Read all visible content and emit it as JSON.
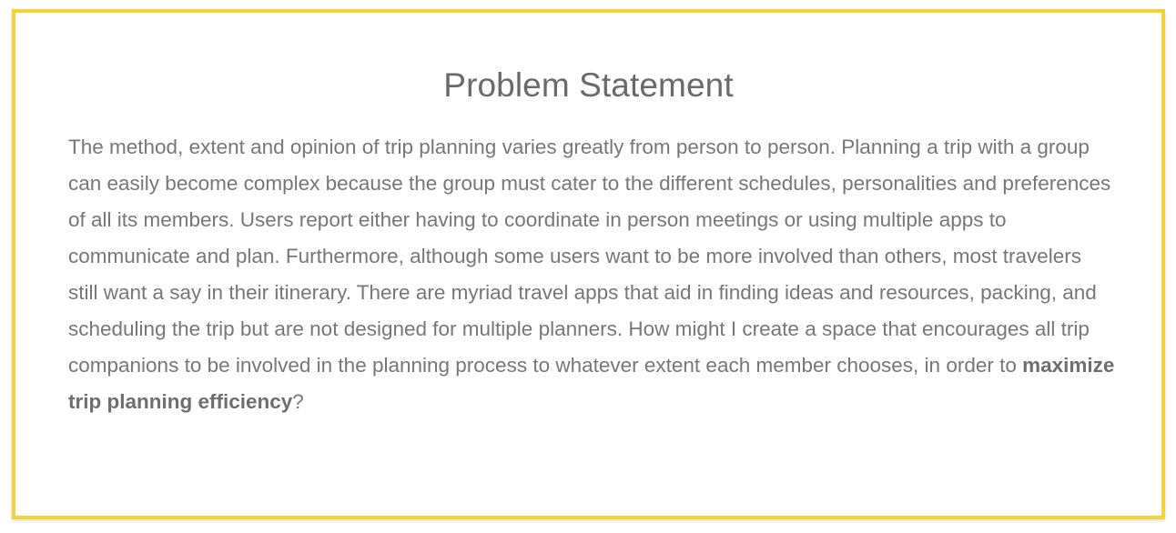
{
  "problem_statement": {
    "title": "Problem Statement",
    "body_before_bold": "The method, extent and opinion of trip planning varies greatly from person to person. Planning a trip with a group can easily become complex because the group must cater to the different schedules, personalities and preferences of all its members. Users report either having to coordinate in person meetings or using multiple apps to communicate and plan. Furthermore, although some users want to be more involved than others, most travelers still want a say in their itinerary. There are myriad travel apps that aid in finding ideas and resources, packing, and scheduling the trip but are not designed for multiple planners. How might I create a space that encourages all trip companions to be involved in the planning process to whatever extent each member chooses, in order to ",
    "body_bold": "maximize trip planning efficiency",
    "body_after_bold": "?"
  },
  "colors": {
    "border": "#f6d332",
    "text": "#777777",
    "title": "#6a6a6a"
  }
}
